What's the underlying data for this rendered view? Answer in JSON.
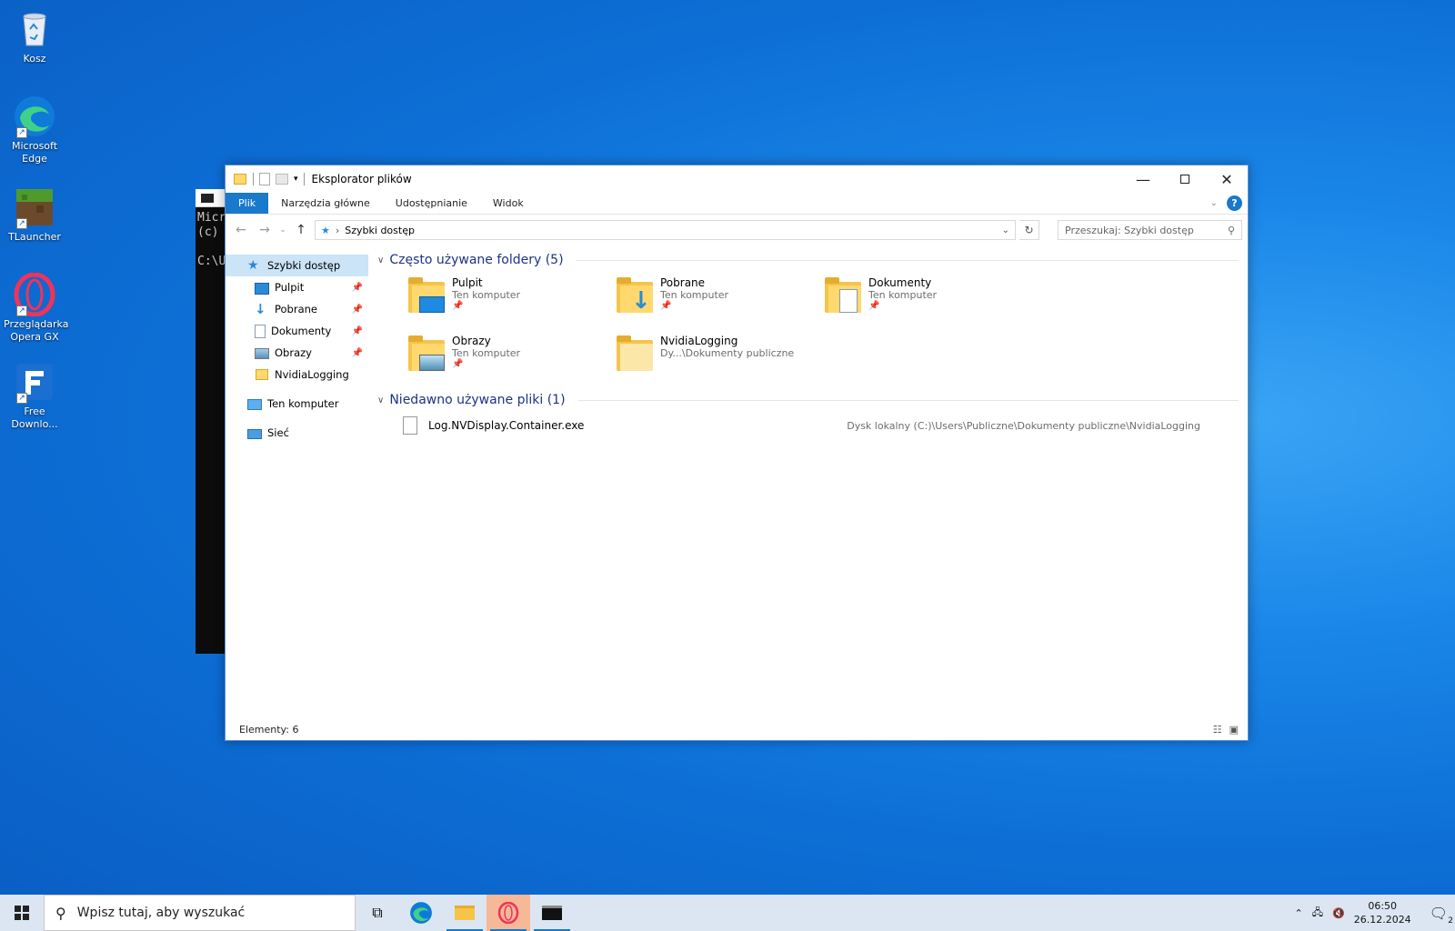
{
  "desktop": {
    "icons": [
      {
        "label": "Kosz"
      },
      {
        "label": "Microsoft Edge"
      },
      {
        "label": "TLauncher"
      },
      {
        "label": "Przeglądarka Opera GX"
      },
      {
        "label": "Free Downlo..."
      }
    ]
  },
  "console": {
    "lines": "Micr\n(c)\n\nC:\\U"
  },
  "explorer": {
    "title": "Eksplorator plików",
    "ribbon_tabs": [
      "Plik",
      "Narzędzia główne",
      "Udostępnianie",
      "Widok"
    ],
    "address": "Szybki dostęp",
    "search_placeholder": "Przeszukaj: Szybki dostęp",
    "nav": {
      "quick_access": "Szybki dostęp",
      "items": [
        "Pulpit",
        "Pobrane",
        "Dokumenty",
        "Obrazy",
        "NvidiaLogging"
      ],
      "this_pc": "Ten komputer",
      "network": "Sieć"
    },
    "frequent_header": "Często używane foldery (5)",
    "frequent_folders": [
      {
        "name": "Pulpit",
        "location": "Ten komputer"
      },
      {
        "name": "Pobrane",
        "location": "Ten komputer"
      },
      {
        "name": "Dokumenty",
        "location": "Ten komputer"
      },
      {
        "name": "Obrazy",
        "location": "Ten komputer"
      },
      {
        "name": "NvidiaLogging",
        "location": "Dy...\\Dokumenty publiczne"
      }
    ],
    "recent_header": "Niedawno używane pliki (1)",
    "recent_files": [
      {
        "name": "Log.NVDisplay.Container.exe",
        "path": "Dysk lokalny (C:)\\Users\\Publiczne\\Dokumenty publiczne\\NvidiaLogging"
      }
    ],
    "status": "Elementy: 6"
  },
  "taskbar": {
    "search_placeholder": "Wpisz tutaj, aby wyszukać",
    "time": "06:50",
    "date": "26.12.2024",
    "notifications": "2"
  },
  "colors": {
    "accent": "#1979ca",
    "group_header": "#1e3287",
    "folder": "#f5c449"
  }
}
